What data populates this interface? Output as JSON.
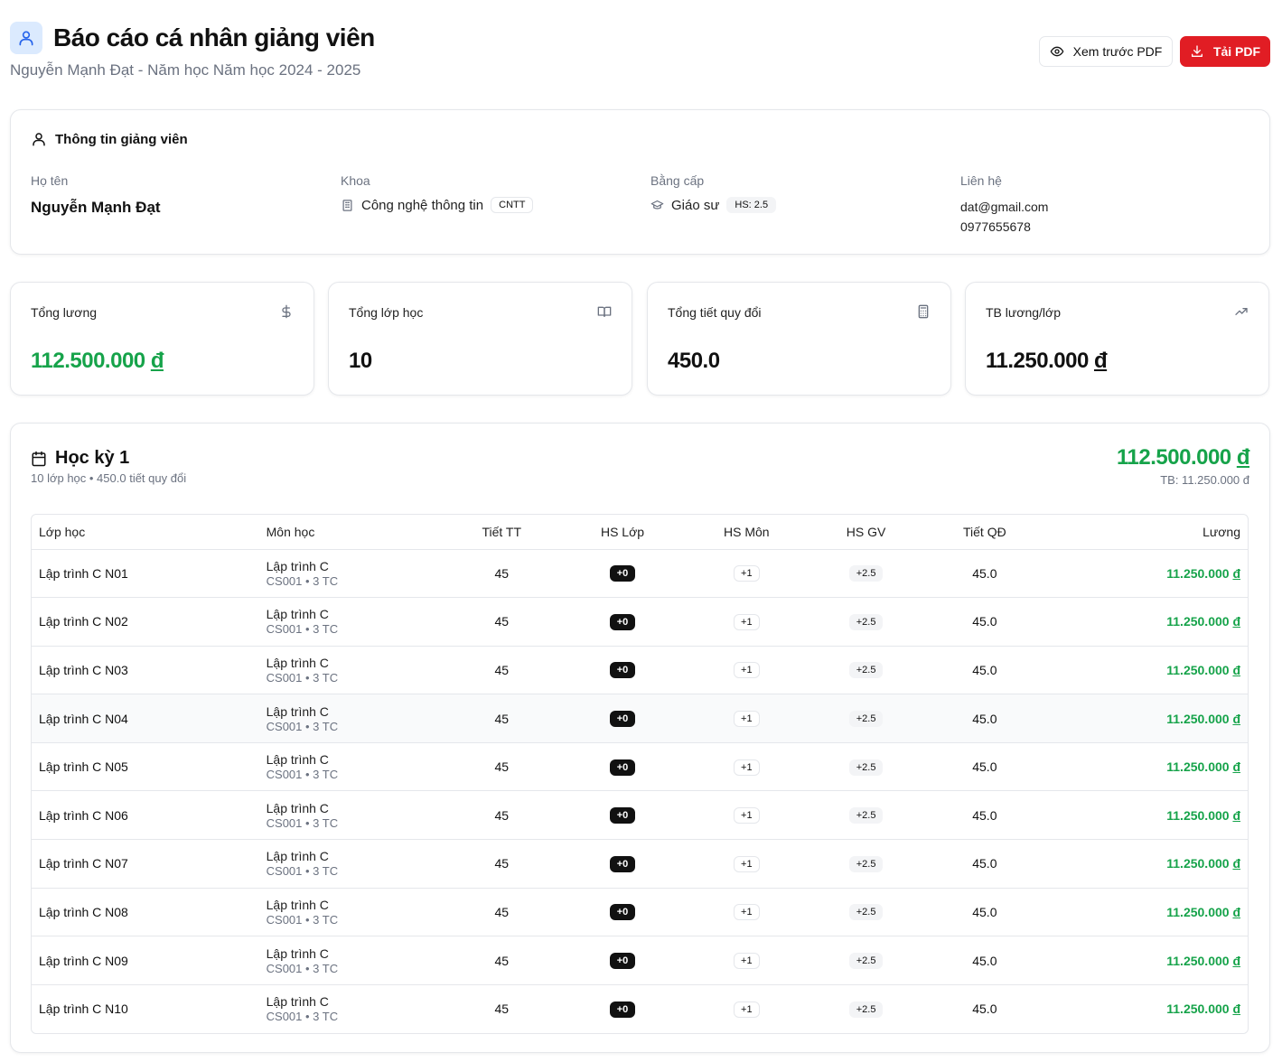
{
  "header": {
    "title": "Báo cáo cá nhân giảng viên",
    "subtitle": "Nguyễn Mạnh Đạt - Năm học Năm học 2024 - 2025",
    "preview_label": "Xem trước PDF",
    "download_label": "Tải PDF"
  },
  "info": {
    "title": "Thông tin giảng viên",
    "name_label": "Họ tên",
    "name": "Nguyễn Mạnh Đạt",
    "faculty_label": "Khoa",
    "faculty": "Công nghệ thông tin",
    "faculty_code": "CNTT",
    "degree_label": "Bằng cấp",
    "degree": "Giáo sư",
    "degree_coef": "HS: 2.5",
    "contact_label": "Liên hệ",
    "email": "dat@gmail.com",
    "phone": "0977655678"
  },
  "stats": [
    {
      "label": "Tổng lương",
      "value_number": "112.500.000",
      "value_unit": "đ",
      "icon": "dollar-icon"
    },
    {
      "label": "Tổng lớp học",
      "value_number": "10",
      "value_unit": "",
      "icon": "book-icon"
    },
    {
      "label": "Tổng tiết quy đổi",
      "value_number": "450.0",
      "value_unit": "",
      "icon": "calculator-icon"
    },
    {
      "label": "TB lương/lớp",
      "value_number": "11.250.000",
      "value_unit": "đ",
      "icon": "trending-up-icon"
    }
  ],
  "semester": {
    "title": "Học kỳ 1",
    "meta": "10 lớp học • 450.0 tiết quy đổi",
    "total_number": "112.500.000",
    "total_unit": "đ",
    "avg": "TB: 11.250.000 đ",
    "columns": [
      "Lớp học",
      "Môn học",
      "Tiết TT",
      "HS Lớp",
      "HS Môn",
      "HS GV",
      "Tiết QĐ",
      "Lương"
    ],
    "rows": [
      {
        "class": "Lập trình C N01",
        "subject": "Lập trình C",
        "subject_meta": "CS001 • 3 TC",
        "periods": "45",
        "hs_class": "+0",
        "hs_subject": "+1",
        "hs_teacher": "+2.5",
        "converted": "45.0",
        "salary_number": "11.250.000",
        "salary_unit": "đ"
      },
      {
        "class": "Lập trình C N02",
        "subject": "Lập trình C",
        "subject_meta": "CS001 • 3 TC",
        "periods": "45",
        "hs_class": "+0",
        "hs_subject": "+1",
        "hs_teacher": "+2.5",
        "converted": "45.0",
        "salary_number": "11.250.000",
        "salary_unit": "đ"
      },
      {
        "class": "Lập trình C N03",
        "subject": "Lập trình C",
        "subject_meta": "CS001 • 3 TC",
        "periods": "45",
        "hs_class": "+0",
        "hs_subject": "+1",
        "hs_teacher": "+2.5",
        "converted": "45.0",
        "salary_number": "11.250.000",
        "salary_unit": "đ"
      },
      {
        "class": "Lập trình C N04",
        "subject": "Lập trình C",
        "subject_meta": "CS001 • 3 TC",
        "periods": "45",
        "hs_class": "+0",
        "hs_subject": "+1",
        "hs_teacher": "+2.5",
        "converted": "45.0",
        "salary_number": "11.250.000",
        "salary_unit": "đ"
      },
      {
        "class": "Lập trình C N05",
        "subject": "Lập trình C",
        "subject_meta": "CS001 • 3 TC",
        "periods": "45",
        "hs_class": "+0",
        "hs_subject": "+1",
        "hs_teacher": "+2.5",
        "converted": "45.0",
        "salary_number": "11.250.000",
        "salary_unit": "đ"
      },
      {
        "class": "Lập trình C N06",
        "subject": "Lập trình C",
        "subject_meta": "CS001 • 3 TC",
        "periods": "45",
        "hs_class": "+0",
        "hs_subject": "+1",
        "hs_teacher": "+2.5",
        "converted": "45.0",
        "salary_number": "11.250.000",
        "salary_unit": "đ"
      },
      {
        "class": "Lập trình C N07",
        "subject": "Lập trình C",
        "subject_meta": "CS001 • 3 TC",
        "periods": "45",
        "hs_class": "+0",
        "hs_subject": "+1",
        "hs_teacher": "+2.5",
        "converted": "45.0",
        "salary_number": "11.250.000",
        "salary_unit": "đ"
      },
      {
        "class": "Lập trình C N08",
        "subject": "Lập trình C",
        "subject_meta": "CS001 • 3 TC",
        "periods": "45",
        "hs_class": "+0",
        "hs_subject": "+1",
        "hs_teacher": "+2.5",
        "converted": "45.0",
        "salary_number": "11.250.000",
        "salary_unit": "đ"
      },
      {
        "class": "Lập trình C N09",
        "subject": "Lập trình C",
        "subject_meta": "CS001 • 3 TC",
        "periods": "45",
        "hs_class": "+0",
        "hs_subject": "+1",
        "hs_teacher": "+2.5",
        "converted": "45.0",
        "salary_number": "11.250.000",
        "salary_unit": "đ"
      },
      {
        "class": "Lập trình C N10",
        "subject": "Lập trình C",
        "subject_meta": "CS001 • 3 TC",
        "periods": "45",
        "hs_class": "+0",
        "hs_subject": "+1",
        "hs_teacher": "+2.5",
        "converted": "45.0",
        "salary_number": "11.250.000",
        "salary_unit": "đ"
      }
    ]
  },
  "colors": {
    "accent_green": "#16a34a",
    "danger_red": "#e11d24",
    "icon_bg_blue": "#dbeafe",
    "icon_blue": "#2563eb"
  }
}
